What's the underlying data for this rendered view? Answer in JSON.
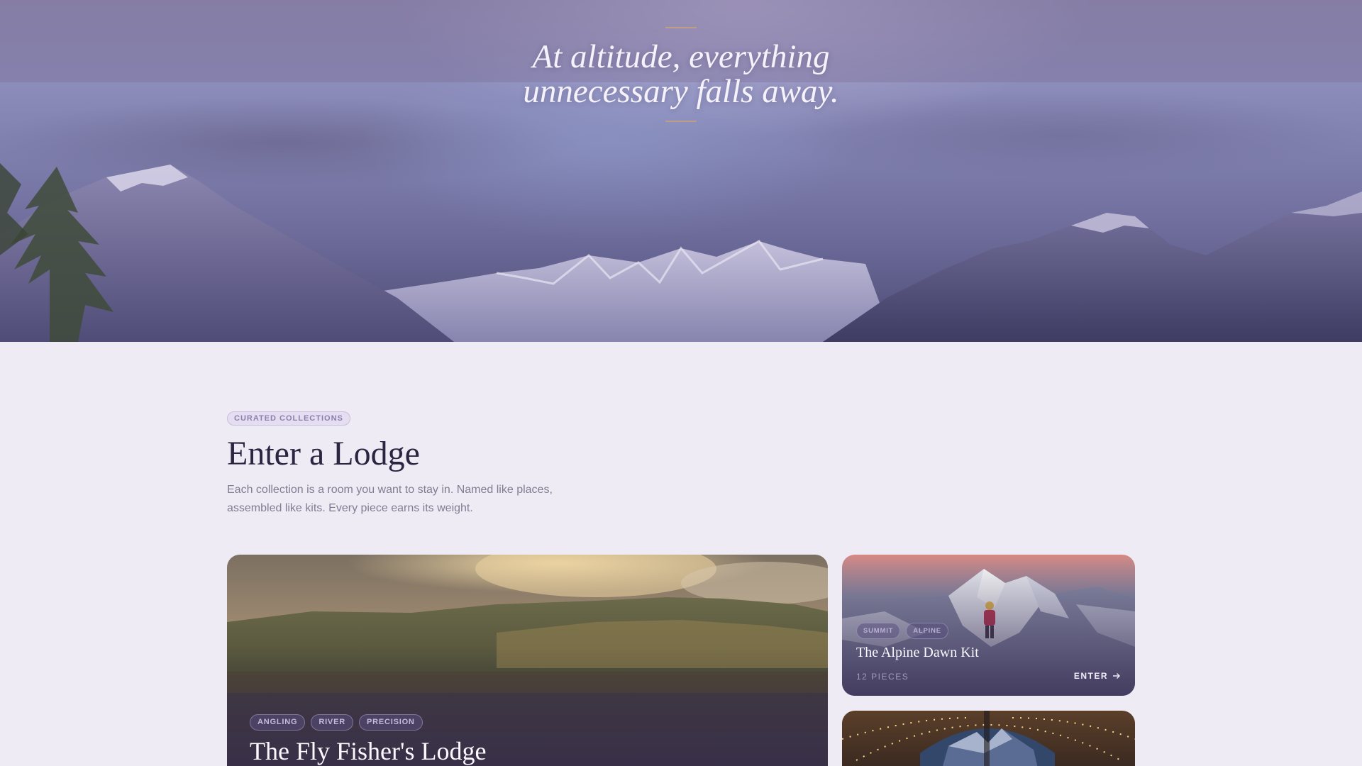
{
  "hero": {
    "quote_line1": "At altitude, everything",
    "quote_line2": "unnecessary falls away."
  },
  "section": {
    "eyebrow": "CURATED COLLECTIONS",
    "title": "Enter a Lodge",
    "description": "Each collection is a room you want to stay in. Named like places, assembled like kits. Every piece earns its weight."
  },
  "cards": {
    "fly_fisher": {
      "tags": [
        "ANGLING",
        "RIVER",
        "PRECISION"
      ],
      "title": "The Fly Fisher's Lodge"
    },
    "alpine_dawn": {
      "tags": [
        "SUMMIT",
        "ALPINE"
      ],
      "title": "The Alpine Dawn Kit",
      "pieces": "12 PIECES",
      "enter_label": "ENTER",
      "enter_icon": "arrow-right-icon"
    },
    "dome": {
      "image": "glamping-dome"
    }
  },
  "colors": {
    "page_bg": "#efebf4",
    "heading": "#2a2540",
    "accent_rule": "#c9a27a",
    "eyebrow_text": "#8b7fb0"
  }
}
